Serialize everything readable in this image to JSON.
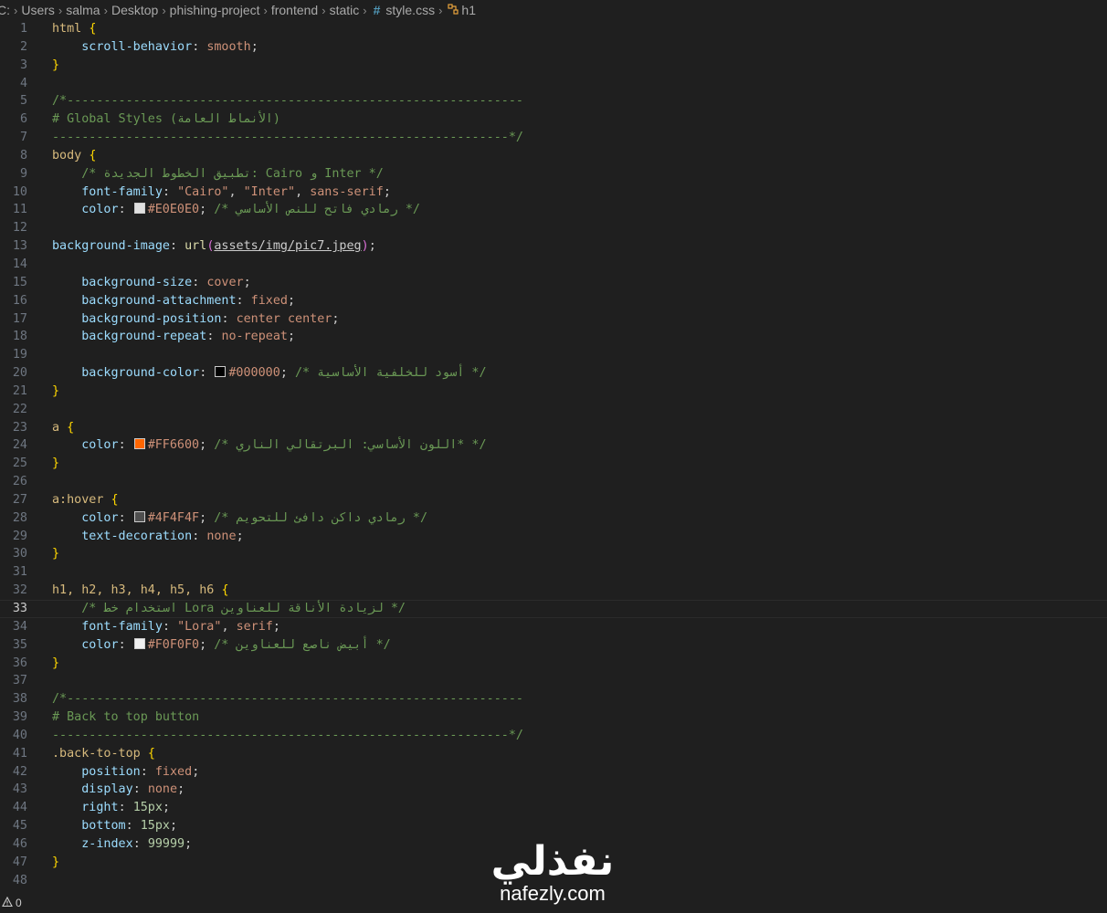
{
  "breadcrumb": {
    "items": [
      "C:",
      "Users",
      "salma",
      "Desktop",
      "phishing-project",
      "frontend",
      "static"
    ],
    "file_icon": "#",
    "file": "style.css",
    "symbol_icon": "symbol-structure-icon",
    "symbol": "h1"
  },
  "editor": {
    "current_line": 33,
    "lines": [
      "html {",
      "    scroll-behavior: smooth;",
      "}",
      "",
      "/*--------------------------------------------------------------",
      "# Global Styles (الأنماط العامة)",
      "--------------------------------------------------------------*/",
      "body {",
      "    /* تطبيق الخطوط الجديدة: Cairo و Inter */",
      "    font-family: \"Cairo\", \"Inter\", sans-serif;",
      "    color: #E0E0E0; /* رمادي فاتح للنص الأساسي */",
      "",
      "background-image: url(assets/img/pic7.jpeg);",
      "",
      "    background-size: cover;",
      "    background-attachment: fixed;",
      "    background-position: center center;",
      "    background-repeat: no-repeat;",
      "",
      "    background-color: #000000; /* أسود للخلفية الأساسية */",
      "}",
      "",
      "a {",
      "    color: #FF6600; /* اللون الأساسي: البرتقالي الناري* */",
      "}",
      "",
      "a:hover {",
      "    color: #4F4F4F; /* رمادي داكن دافئ للتحويم */",
      "    text-decoration: none;",
      "}",
      "",
      "h1, h2, h3, h4, h5, h6 {",
      "    /* استخدام خط Lora لزيادة الأناقة للعناوين */",
      "    font-family: \"Lora\", serif;",
      "    color: #F0F0F0; /* أبيض ناصع للعناوين */",
      "}",
      "",
      "/*--------------------------------------------------------------",
      "# Back to top button",
      "--------------------------------------------------------------*/",
      ".back-to-top {",
      "    position: fixed;",
      "    display: none;",
      "    right: 15px;",
      "    bottom: 15px;",
      "    z-index: 99999;",
      "}",
      ""
    ]
  },
  "status_bar": {
    "warning_icon": "warning-icon",
    "warnings": "0"
  },
  "watermark": {
    "arabic": "نفذلي",
    "latin": "nafezly.com"
  },
  "colors": {
    "background": "#1f1f1f",
    "swatch_E0E0E0": "#E0E0E0",
    "swatch_000000": "#000000",
    "swatch_FF6600": "#FF6600",
    "swatch_4F4F4F": "#4F4F4F",
    "swatch_F0F0F0": "#F0F0F0"
  }
}
